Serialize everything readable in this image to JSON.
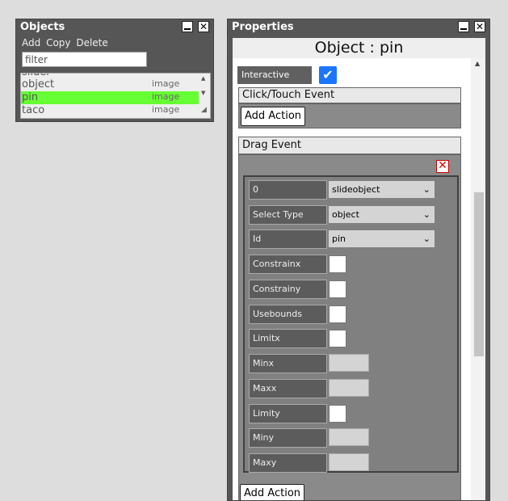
{
  "objects_panel": {
    "title": "Objects",
    "toolbar": {
      "add": "Add",
      "copy": "Copy",
      "delete": "Delete"
    },
    "filter_placeholder": "filter",
    "items": [
      {
        "name": "slider",
        "type": ""
      },
      {
        "name": "object",
        "type": "image"
      },
      {
        "name": "pin",
        "type": "image",
        "selected": true
      },
      {
        "name": "taco",
        "type": "image"
      }
    ]
  },
  "properties_panel": {
    "title": "Properties",
    "header": "Object : pin",
    "interactive_label": "Interactive",
    "interactive_checked": true,
    "click_event": {
      "title": "Click/Touch Event",
      "add_action": "Add Action"
    },
    "drag_event": {
      "title": "Drag Event",
      "add_action": "Add Action",
      "fields": {
        "action_index": "0",
        "action_value": "slideobject",
        "select_type_label": "Select Type",
        "select_type_value": "object",
        "id_label": "Id",
        "id_value": "pin",
        "constrainx": "Constrainx",
        "constrainy": "Constrainy",
        "usebounds": "Usebounds",
        "limitx": "Limitx",
        "minx": "Minx",
        "maxx": "Maxx",
        "limity": "Limity",
        "miny": "Miny",
        "maxy": "Maxy"
      }
    }
  },
  "window_controls": {
    "minimize": "",
    "close": "✕"
  },
  "colors": {
    "selected_row": "#66ff33",
    "checkbox_checked": "#1a75ff",
    "panel_bg": "#565656"
  }
}
